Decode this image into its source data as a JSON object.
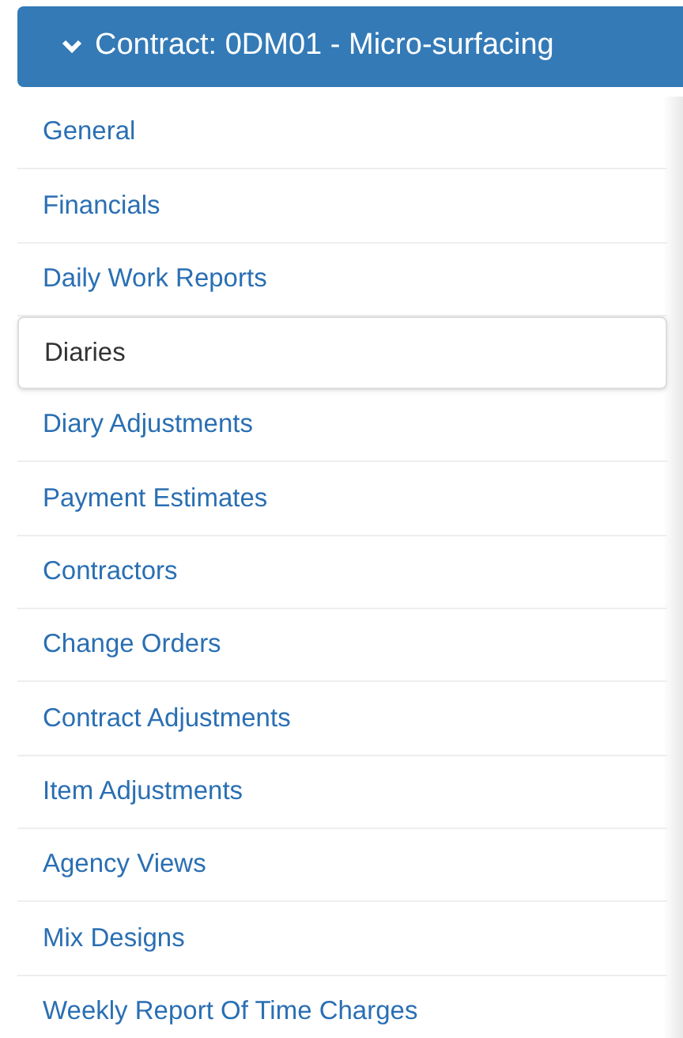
{
  "header": {
    "title": "Contract: 0DM01 - Micro-surfacing",
    "expanded": true
  },
  "menu": [
    {
      "label": "General",
      "selected": false
    },
    {
      "label": "Financials",
      "selected": false
    },
    {
      "label": "Daily Work Reports",
      "selected": false
    },
    {
      "label": "Diaries",
      "selected": true
    },
    {
      "label": "Diary Adjustments",
      "selected": false
    },
    {
      "label": "Payment Estimates",
      "selected": false
    },
    {
      "label": "Contractors",
      "selected": false
    },
    {
      "label": "Change Orders",
      "selected": false
    },
    {
      "label": "Contract Adjustments",
      "selected": false
    },
    {
      "label": "Item Adjustments",
      "selected": false
    },
    {
      "label": "Agency Views",
      "selected": false
    },
    {
      "label": "Mix Designs",
      "selected": false
    },
    {
      "label": "Weekly Report Of Time Charges",
      "selected": false
    }
  ]
}
